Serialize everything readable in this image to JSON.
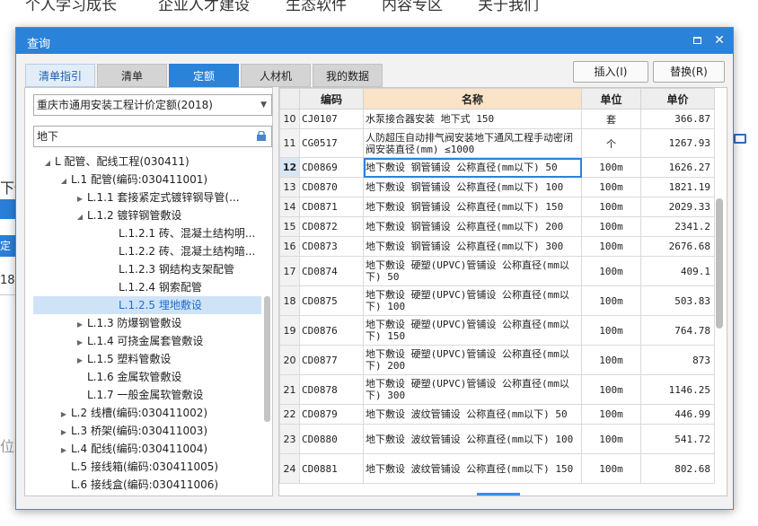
{
  "background": {
    "nav_items": [
      "个人学习成长",
      "企业人才建设",
      "生态软件",
      "内容专区",
      "关于我们"
    ],
    "left_fragments": [
      "下僚",
      "定",
      "18",
      "位"
    ]
  },
  "dialog": {
    "title": "查询",
    "tabs": [
      "清单指引",
      "清单",
      "定额",
      "人材机",
      "我的数据"
    ],
    "insert_label": "插入(I)",
    "replace_label": "替换(R)"
  },
  "left": {
    "quota_select": "重庆市通用安装工程计价定额(2018)",
    "search_value": "地下",
    "tree": [
      {
        "label": "L 配管、配线工程(030411)",
        "level": 0,
        "toggle": "open"
      },
      {
        "label": "L.1 配管(编码:030411001)",
        "level": 1,
        "toggle": "open"
      },
      {
        "label": "L.1.1 套接紧定式镀锌钢导管(...",
        "level": 2,
        "toggle": "closed"
      },
      {
        "label": "L.1.2 镀锌钢管敷设",
        "level": 2,
        "toggle": "open"
      },
      {
        "label": "L.1.2.1 砖、混凝土结构明...",
        "level": 3,
        "toggle": ""
      },
      {
        "label": "L.1.2.2 砖、混凝土结构暗...",
        "level": 3,
        "toggle": ""
      },
      {
        "label": "L.1.2.3 钢结构支架配管",
        "level": 3,
        "toggle": ""
      },
      {
        "label": "L.1.2.4 钢索配管",
        "level": 3,
        "toggle": ""
      },
      {
        "label": "L.1.2.5 埋地敷设",
        "level": 3,
        "toggle": "",
        "selected": true
      },
      {
        "label": "L.1.3 防爆钢管敷设",
        "level": 2,
        "toggle": "closed"
      },
      {
        "label": "L.1.4 可挠金属套管敷设",
        "level": 2,
        "toggle": "closed"
      },
      {
        "label": "L.1.5 塑料管敷设",
        "level": 2,
        "toggle": "closed"
      },
      {
        "label": "L.1.6 金属软管敷设",
        "level": 2,
        "toggle": ""
      },
      {
        "label": "L.1.7 一般金属软管敷设",
        "level": 2,
        "toggle": ""
      },
      {
        "label": "L.2 线槽(编码:030411002)",
        "level": 1,
        "toggle": "closed"
      },
      {
        "label": "L.3 桥架(编码:030411003)",
        "level": 1,
        "toggle": "closed"
      },
      {
        "label": "L.4 配线(编码:030411004)",
        "level": 1,
        "toggle": "closed"
      },
      {
        "label": "L.5 接线箱(编码:030411005)",
        "level": 1,
        "toggle": ""
      },
      {
        "label": "L.6 接线盒(编码:030411006)",
        "level": 1,
        "toggle": ""
      }
    ]
  },
  "grid": {
    "headers": [
      "",
      "编码",
      "名称",
      "单位",
      "单价"
    ],
    "rows": [
      {
        "no": "10",
        "code": "CJ0107",
        "name": "水泵接合器安装 地下式 150",
        "unit": "套",
        "price": "366.87"
      },
      {
        "no": "11",
        "code": "CG0517",
        "name": "人防超压自动排气阀安装地下通风工程手动密闭阀安装直径(mm) ≤1000",
        "unit": "个",
        "price": "1267.93"
      },
      {
        "no": "12",
        "code": "CD0869",
        "name": "地下敷设 钢管铺设 公称直径(mm以下) 50",
        "unit": "100m",
        "price": "1626.27",
        "current": true
      },
      {
        "no": "13",
        "code": "CD0870",
        "name": "地下敷设 钢管铺设 公称直径(mm以下) 100",
        "unit": "100m",
        "price": "1821.19"
      },
      {
        "no": "14",
        "code": "CD0871",
        "name": "地下敷设 钢管铺设 公称直径(mm以下) 150",
        "unit": "100m",
        "price": "2029.33"
      },
      {
        "no": "15",
        "code": "CD0872",
        "name": "地下敷设 钢管铺设 公称直径(mm以下) 200",
        "unit": "100m",
        "price": "2341.2"
      },
      {
        "no": "16",
        "code": "CD0873",
        "name": "地下敷设 钢管铺设 公称直径(mm以下) 300",
        "unit": "100m",
        "price": "2676.68"
      },
      {
        "no": "17",
        "code": "CD0874",
        "name": "地下敷设 硬塑(UPVC)管铺设 公称直径(mm以下) 50",
        "unit": "100m",
        "price": "409.1"
      },
      {
        "no": "18",
        "code": "CD0875",
        "name": "地下敷设 硬塑(UPVC)管铺设 公称直径(mm以下) 100",
        "unit": "100m",
        "price": "503.83"
      },
      {
        "no": "19",
        "code": "CD0876",
        "name": "地下敷设 硬塑(UPVC)管铺设 公称直径(mm以下) 150",
        "unit": "100m",
        "price": "764.78"
      },
      {
        "no": "20",
        "code": "CD0877",
        "name": "地下敷设 硬塑(UPVC)管铺设 公称直径(mm以下) 200",
        "unit": "100m",
        "price": "873"
      },
      {
        "no": "21",
        "code": "CD0878",
        "name": "地下敷设 硬塑(UPVC)管铺设 公称直径(mm以下) 300",
        "unit": "100m",
        "price": "1146.25"
      },
      {
        "no": "22",
        "code": "CD0879",
        "name": "地下敷设 波纹管铺设 公称直径(mm以下) 50",
        "unit": "100m",
        "price": "446.99"
      },
      {
        "no": "23",
        "code": "CD0880",
        "name": "地下敷设 波纹管铺设 公称直径(mm以下) 100",
        "unit": "100m",
        "price": "541.72"
      },
      {
        "no": "24",
        "code": "CD0881",
        "name": "地下敷设 波纹管铺设 公称直径(mm以下) 150",
        "unit": "100m",
        "price": "802.68"
      }
    ]
  }
}
